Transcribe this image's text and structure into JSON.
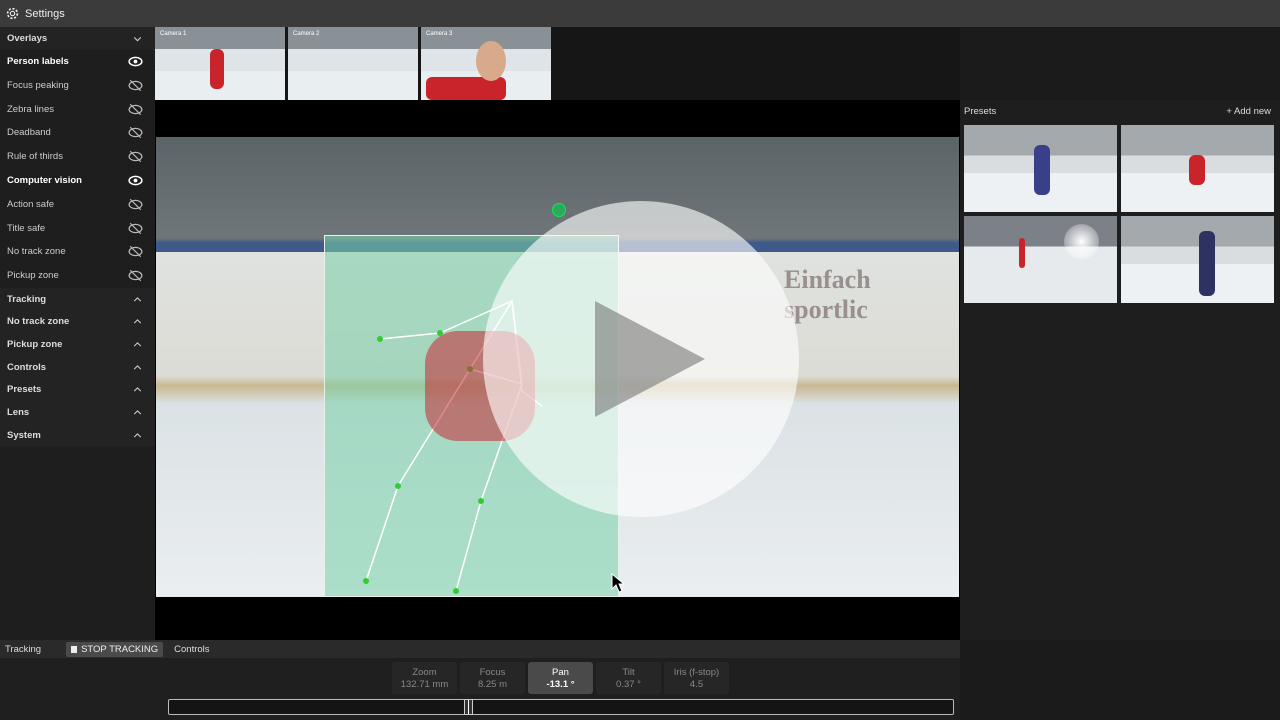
{
  "topbar": {
    "title": "Settings",
    "icon": "gear-icon"
  },
  "sidebar": {
    "items": [
      {
        "label": "Overlays",
        "type": "section",
        "icon": "chevron-down-icon"
      },
      {
        "label": "Person labels",
        "icon": "eye-icon",
        "active": true
      },
      {
        "label": "Focus peaking",
        "icon": "eye-off-icon"
      },
      {
        "label": "Zebra lines",
        "icon": "eye-off-icon"
      },
      {
        "label": "Deadband",
        "icon": "eye-off-icon"
      },
      {
        "label": "Rule of thirds",
        "icon": "eye-off-icon"
      },
      {
        "label": "Computer vision",
        "icon": "eye-icon",
        "active": true
      },
      {
        "label": "Action safe",
        "icon": "eye-off-icon"
      },
      {
        "label": "Title safe",
        "icon": "eye-off-icon"
      },
      {
        "label": "No track zone",
        "icon": "eye-off-icon"
      },
      {
        "label": "Pickup zone",
        "icon": "eye-off-icon"
      },
      {
        "label": "Tracking",
        "type": "section",
        "icon": "chevron-up-icon"
      },
      {
        "label": "No track zone",
        "type": "section",
        "icon": "chevron-up-icon"
      },
      {
        "label": "Pickup zone",
        "type": "section",
        "icon": "chevron-up-icon"
      },
      {
        "label": "Controls",
        "type": "section",
        "icon": "chevron-up-icon"
      },
      {
        "label": "Presets",
        "type": "section",
        "icon": "chevron-up-icon"
      },
      {
        "label": "Lens",
        "type": "section",
        "icon": "chevron-up-icon"
      },
      {
        "label": "System",
        "type": "section",
        "icon": "chevron-up-icon"
      }
    ]
  },
  "cameras": [
    {
      "label": "Camera 1"
    },
    {
      "label": "Camera 2"
    },
    {
      "label": "Camera 3"
    }
  ],
  "video": {
    "background_text": "Einfach sportlic"
  },
  "presets": {
    "title": "Presets",
    "add_label": "+ Add new"
  },
  "bottom": {
    "tab_tracking": "Tracking",
    "stop_label": "STOP TRACKING",
    "tab_controls": "Controls",
    "controls": [
      {
        "label": "Zoom",
        "value": "132.71 mm"
      },
      {
        "label": "Focus",
        "value": "8.25 m"
      },
      {
        "label": "Pan",
        "value": "-13.1 °",
        "active": true
      },
      {
        "label": "Tilt",
        "value": "0.37 °"
      },
      {
        "label": "Iris (f-stop)",
        "value": "4.5"
      }
    ],
    "slider_fraction": 0.38
  }
}
